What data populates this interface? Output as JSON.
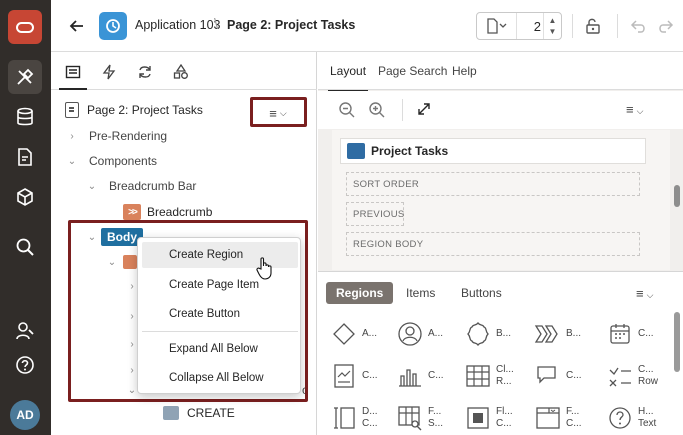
{
  "left_rail": {
    "avatar_initials": "AD"
  },
  "topbar": {
    "app_name": "Application 103",
    "separator": "\\",
    "page_name": "Page 2: Project Tasks",
    "page_number": "2"
  },
  "left_panel": {
    "title": "Page 2: Project Tasks",
    "tree": {
      "pre_rendering": "Pre-Rendering",
      "components": "Components",
      "breadcrumb_bar": "Breadcrumb Bar",
      "breadcrumb": "Breadcrumb",
      "body": "Body",
      "create": "CREATE",
      "partial_suffix": "c"
    },
    "context_menu": {
      "items": [
        "Create Region",
        "Create Page Item",
        "Create Button",
        "Expand All Below",
        "Collapse All Below"
      ]
    }
  },
  "right_panel": {
    "tabs": [
      "Layout",
      "Page Search",
      "Help"
    ],
    "region_title": "Project Tasks",
    "slots": [
      "SORT ORDER",
      "PREVIOUS",
      "REGION BODY"
    ],
    "gallery_tabs": [
      "Regions",
      "Items",
      "Buttons"
    ],
    "gallery_items": [
      {
        "l1": "A...",
        "l2": ""
      },
      {
        "l1": "A...",
        "l2": ""
      },
      {
        "l1": "B...",
        "l2": ""
      },
      {
        "l1": "B...",
        "l2": ""
      },
      {
        "l1": "C...",
        "l2": ""
      },
      {
        "l1": "C...",
        "l2": ""
      },
      {
        "l1": "C...",
        "l2": ""
      },
      {
        "l1": "Cl...",
        "l2": "R..."
      },
      {
        "l1": "C...",
        "l2": ""
      },
      {
        "l1": "C...",
        "l2": "Row"
      },
      {
        "l1": "D...",
        "l2": "C..."
      },
      {
        "l1": "F...",
        "l2": "S..."
      },
      {
        "l1": "Fl...",
        "l2": "C..."
      },
      {
        "l1": "F...",
        "l2": "C..."
      },
      {
        "l1": "H...",
        "l2": "Text"
      }
    ]
  },
  "colors": {
    "accent_oracle": "#c74634",
    "highlight_border": "#7a1f1f",
    "body_badge": "#1f6fa0",
    "app_icon": "#3a94d6"
  }
}
